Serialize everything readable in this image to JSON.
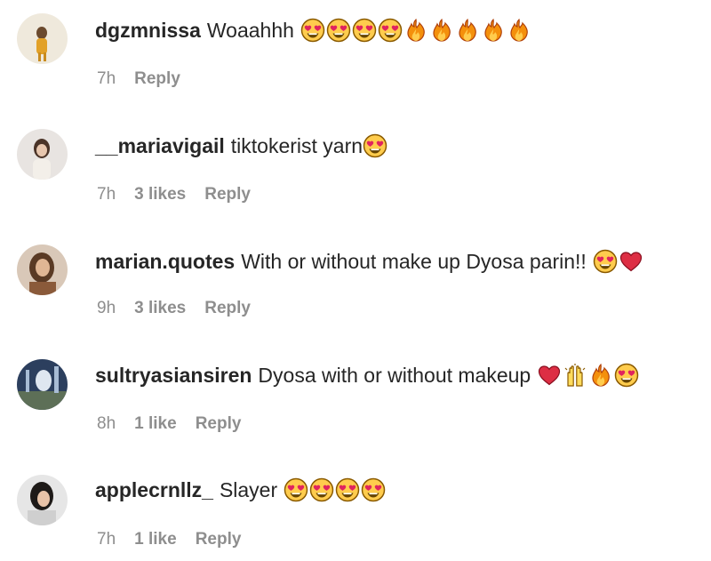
{
  "comments": [
    {
      "username": "dgzmnissa",
      "text": "Woaahhh",
      "emojis": [
        "heart-eyes",
        "heart-eyes",
        "heart-eyes",
        "heart-eyes",
        "fire",
        "fire",
        "fire",
        "fire",
        "fire"
      ],
      "time": "7h",
      "likes": "",
      "reply": "Reply"
    },
    {
      "username": "__mariavigail",
      "text": "tiktokerist yarn",
      "emojis": [
        "heart-eyes"
      ],
      "time": "7h",
      "likes": "3 likes",
      "reply": "Reply"
    },
    {
      "username": "marian.quotes",
      "text": "With or without make up Dyosa parin!!",
      "emojis": [
        "heart-eyes",
        "red-heart"
      ],
      "time": "9h",
      "likes": "3 likes",
      "reply": "Reply"
    },
    {
      "username": "sultryasiansiren",
      "text": "Dyosa with or without makeup",
      "emojis": [
        "red-heart",
        "raised-hands",
        "fire",
        "heart-eyes"
      ],
      "time": "8h",
      "likes": "1 like",
      "reply": "Reply"
    },
    {
      "username": "applecrnllz_",
      "text": "Slayer",
      "emojis": [
        "heart-eyes",
        "heart-eyes",
        "heart-eyes",
        "heart-eyes"
      ],
      "time": "7h",
      "likes": "1 like",
      "reply": "Reply"
    }
  ],
  "colors": {
    "username": "#262626",
    "meta": "#8e8e8e",
    "background": "#ffffff"
  }
}
